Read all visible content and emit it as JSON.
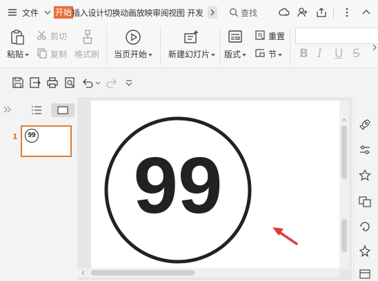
{
  "menubar": {
    "file_label": "文件",
    "active_tab": "开始",
    "tabs_text": "插入设计切换动画放映审阅视图 开发",
    "search_label": "查找"
  },
  "ribbon": {
    "paste": "粘贴",
    "cut": "剪切",
    "copy": "复制",
    "format_painter": "格式刷",
    "from_current": "当页开始",
    "new_slide": "新建幻灯片",
    "layout": "版式",
    "reset": "重置",
    "section": "节",
    "format_bold": "B",
    "format_italic": "I",
    "format_underline": "U",
    "format_strike": "S"
  },
  "slide_panel": {
    "thumbnail_number": "1",
    "thumbnail_badge": "99"
  },
  "slide": {
    "badge_number": "99"
  },
  "colors": {
    "accent_orange": "#e86d3a",
    "arrow_red": "#e0393a",
    "badge_ink": "#222222"
  }
}
